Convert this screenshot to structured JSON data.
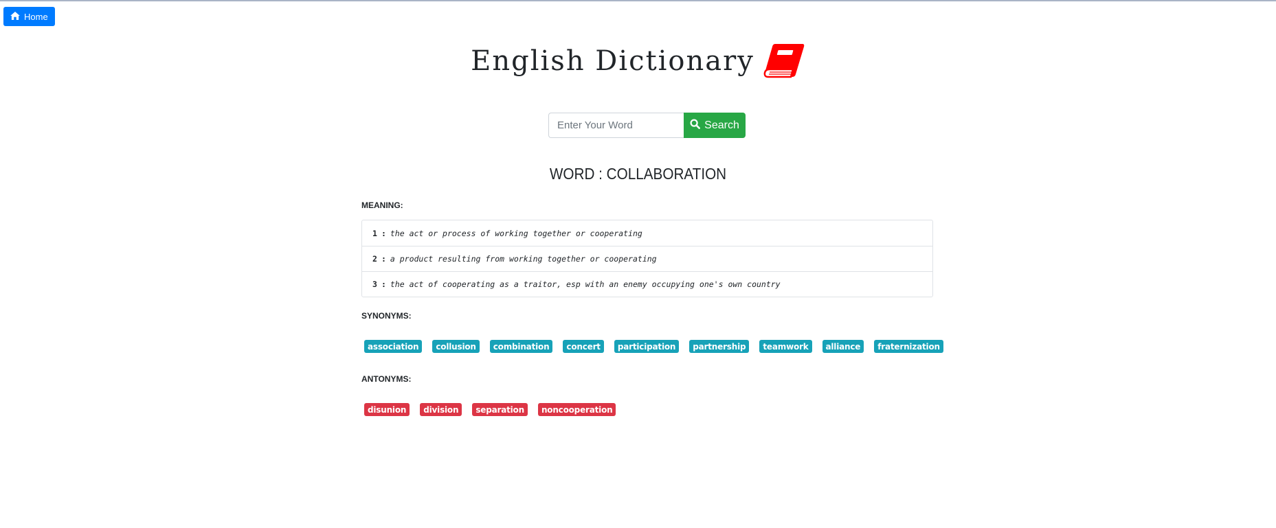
{
  "nav": {
    "home_label": "Home",
    "home_icon": "home-icon"
  },
  "header": {
    "title": "English Dictionary",
    "logo_icon": "book-icon",
    "logo_color": "#ff0000"
  },
  "search": {
    "placeholder": "Enter Your Word",
    "value": "",
    "button_label": "Search",
    "button_icon": "search-icon"
  },
  "result": {
    "word_heading": "WORD : COLLABORATION",
    "meaning_label": "MEANING:",
    "meanings": [
      {
        "num": "1",
        "sep": ":",
        "def": "the act or process of working together or cooperating"
      },
      {
        "num": "2",
        "sep": ":",
        "def": "a product resulting from working together or cooperating"
      },
      {
        "num": "3",
        "sep": ":",
        "def": "the act of cooperating as a traitor, esp with an enemy occupying one's own country"
      }
    ],
    "synonyms_label": "SYNONYMS:",
    "synonyms": [
      "association",
      "collusion",
      "combination",
      "concert",
      "participation",
      "partnership",
      "teamwork",
      "alliance",
      "fraternization"
    ],
    "antonyms_label": "ANTONYMS:",
    "antonyms": [
      "disunion",
      "division",
      "separation",
      "noncooperation"
    ]
  },
  "colors": {
    "home": "#007bff",
    "search": "#28a745",
    "synonym": "#17a2b8",
    "antonym": "#dc3545"
  }
}
